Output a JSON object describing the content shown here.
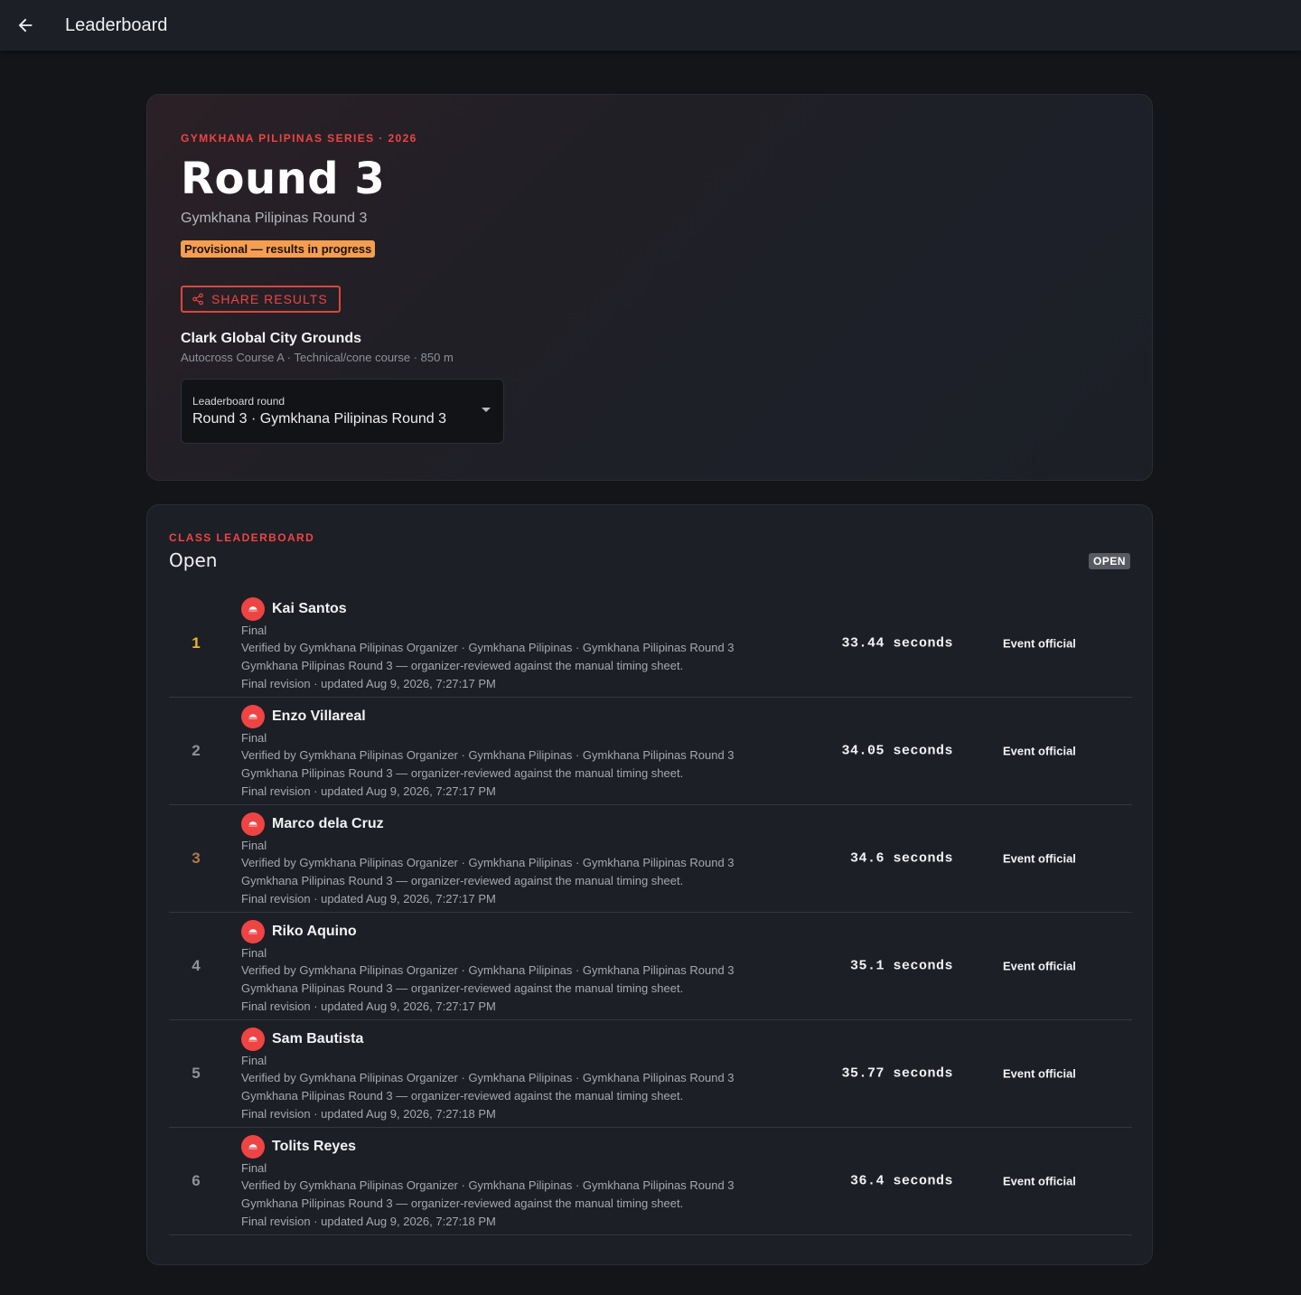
{
  "appbar": {
    "title": "Leaderboard"
  },
  "hero": {
    "eyebrow": "GYMKHANA PILIPINAS SERIES · 2026",
    "title": "Round 3",
    "subtitle": "Gymkhana Pilipinas Round 3",
    "status_badge": "Provisional — results in progress",
    "share_label": "SHARE RESULTS",
    "venue_name": "Clark Global City Grounds",
    "venue_desc": "Autocross Course A · Technical/cone course · 850 m",
    "round_select": {
      "label": "Leaderboard round",
      "value": "Round 3 · Gymkhana Pilipinas Round 3"
    }
  },
  "board": {
    "eyebrow": "CLASS LEADERBOARD",
    "class_name": "Open",
    "chip": "OPEN",
    "rows": [
      {
        "rank": "1",
        "name": "Kai Santos",
        "status": "Final",
        "verified": "Verified by Gymkhana Pilipinas Organizer · Gymkhana Pilipinas · Gymkhana Pilipinas Round 3",
        "note": "Gymkhana Pilipinas Round 3 — organizer-reviewed against the manual timing sheet.",
        "revision": "Final revision · updated Aug 9, 2026, 7:27:17 PM",
        "time": "33.44 seconds",
        "source": "Event official"
      },
      {
        "rank": "2",
        "name": "Enzo Villareal",
        "status": "Final",
        "verified": "Verified by Gymkhana Pilipinas Organizer · Gymkhana Pilipinas · Gymkhana Pilipinas Round 3",
        "note": "Gymkhana Pilipinas Round 3 — organizer-reviewed against the manual timing sheet.",
        "revision": "Final revision · updated Aug 9, 2026, 7:27:17 PM",
        "time": "34.05 seconds",
        "source": "Event official"
      },
      {
        "rank": "3",
        "name": "Marco dela Cruz",
        "status": "Final",
        "verified": "Verified by Gymkhana Pilipinas Organizer · Gymkhana Pilipinas · Gymkhana Pilipinas Round 3",
        "note": "Gymkhana Pilipinas Round 3 — organizer-reviewed against the manual timing sheet.",
        "revision": "Final revision · updated Aug 9, 2026, 7:27:17 PM",
        "time": "34.6 seconds",
        "source": "Event official"
      },
      {
        "rank": "4",
        "name": "Riko Aquino",
        "status": "Final",
        "verified": "Verified by Gymkhana Pilipinas Organizer · Gymkhana Pilipinas · Gymkhana Pilipinas Round 3",
        "note": "Gymkhana Pilipinas Round 3 — organizer-reviewed against the manual timing sheet.",
        "revision": "Final revision · updated Aug 9, 2026, 7:27:17 PM",
        "time": "35.1 seconds",
        "source": "Event official"
      },
      {
        "rank": "5",
        "name": "Sam Bautista",
        "status": "Final",
        "verified": "Verified by Gymkhana Pilipinas Organizer · Gymkhana Pilipinas · Gymkhana Pilipinas Round 3",
        "note": "Gymkhana Pilipinas Round 3 — organizer-reviewed against the manual timing sheet.",
        "revision": "Final revision · updated Aug 9, 2026, 7:27:18 PM",
        "time": "35.77 seconds",
        "source": "Event official"
      },
      {
        "rank": "6",
        "name": "Tolits Reyes",
        "status": "Final",
        "verified": "Verified by Gymkhana Pilipinas Organizer · Gymkhana Pilipinas · Gymkhana Pilipinas Round 3",
        "note": "Gymkhana Pilipinas Round 3 — organizer-reviewed against the manual timing sheet.",
        "revision": "Final revision · updated Aug 9, 2026, 7:27:18 PM",
        "time": "36.4 seconds",
        "source": "Event official"
      }
    ]
  },
  "colors": {
    "accent": "#ef4444",
    "provisional": "#f59e51",
    "gold": "#f0b429",
    "bronze": "#b07a45"
  },
  "icons": {
    "back": "arrow-left-icon",
    "share": "share-icon",
    "avatar": "helmet-icon",
    "select": "caret-down-icon"
  }
}
